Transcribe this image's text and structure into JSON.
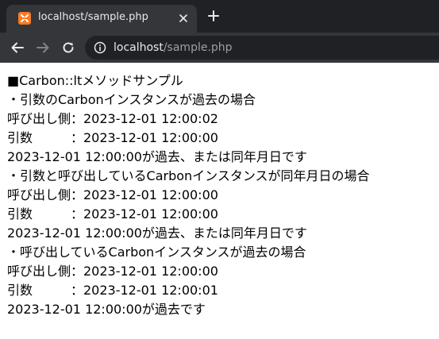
{
  "browser": {
    "tab": {
      "title": "localhost/sample.php"
    },
    "address_bar": {
      "host": "localhost",
      "path": "/sample.php"
    }
  },
  "colors": {
    "tab_strip_bg": "#202124",
    "active_tab_bg": "#35363a",
    "favicon": "#fb7a24",
    "page_bg": "#ffffff",
    "text": "#000000"
  },
  "icons": {
    "favicon": "xampp-favicon-icon",
    "close": "close-icon",
    "new_tab": "plus-icon",
    "back": "arrow-left-icon",
    "forward": "arrow-right-icon",
    "reload": "reload-icon",
    "site_info": "info-icon"
  },
  "page": {
    "lines": [
      "■Carbon::ltメソッドサンプル",
      "・引数のCarbonインスタンスが過去の場合",
      "呼び出し側：2023-12-01 12:00:02",
      "引数　　　：2023-12-01 12:00:00",
      "2023-12-01 12:00:00が過去、または同年月日です",
      "・引数と呼び出しているCarbonインスタンスが同年月日の場合",
      "呼び出し側：2023-12-01 12:00:00",
      "引数　　　：2023-12-01 12:00:00",
      "2023-12-01 12:00:00が過去、または同年月日です",
      "・呼び出しているCarbonインスタンスが過去の場合",
      "呼び出し側：2023-12-01 12:00:00",
      "引数　　　：2023-12-01 12:00:01",
      "2023-12-01 12:00:00が過去です"
    ]
  }
}
